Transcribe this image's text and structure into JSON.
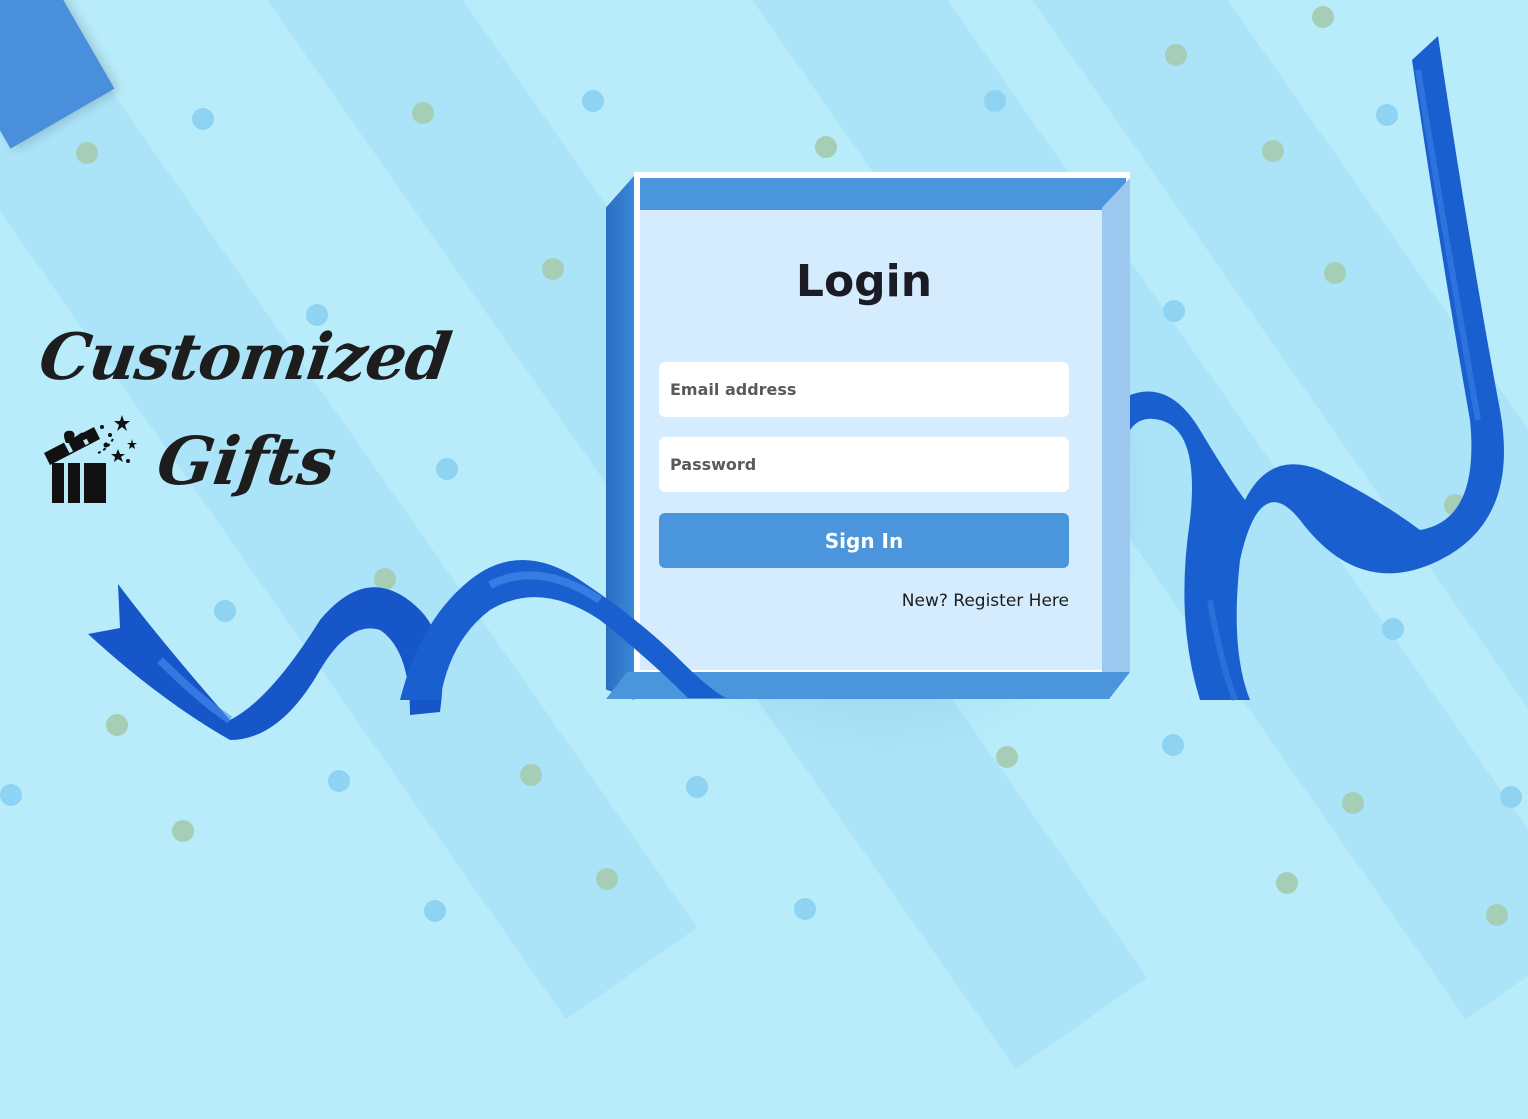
{
  "brand": {
    "line1": "Customized",
    "line2": "Gifts"
  },
  "login": {
    "title": "Login",
    "email_placeholder": "Email address",
    "password_placeholder": "Password",
    "signin_label": "Sign In",
    "register_link": "New? Register Here"
  },
  "colors": {
    "background": "#b8ecfb",
    "accent": "#4a95db",
    "ribbon": "#1a5fd0",
    "card": "#d4ecfd"
  },
  "icons": {
    "gift": "gift-box-open-icon"
  }
}
